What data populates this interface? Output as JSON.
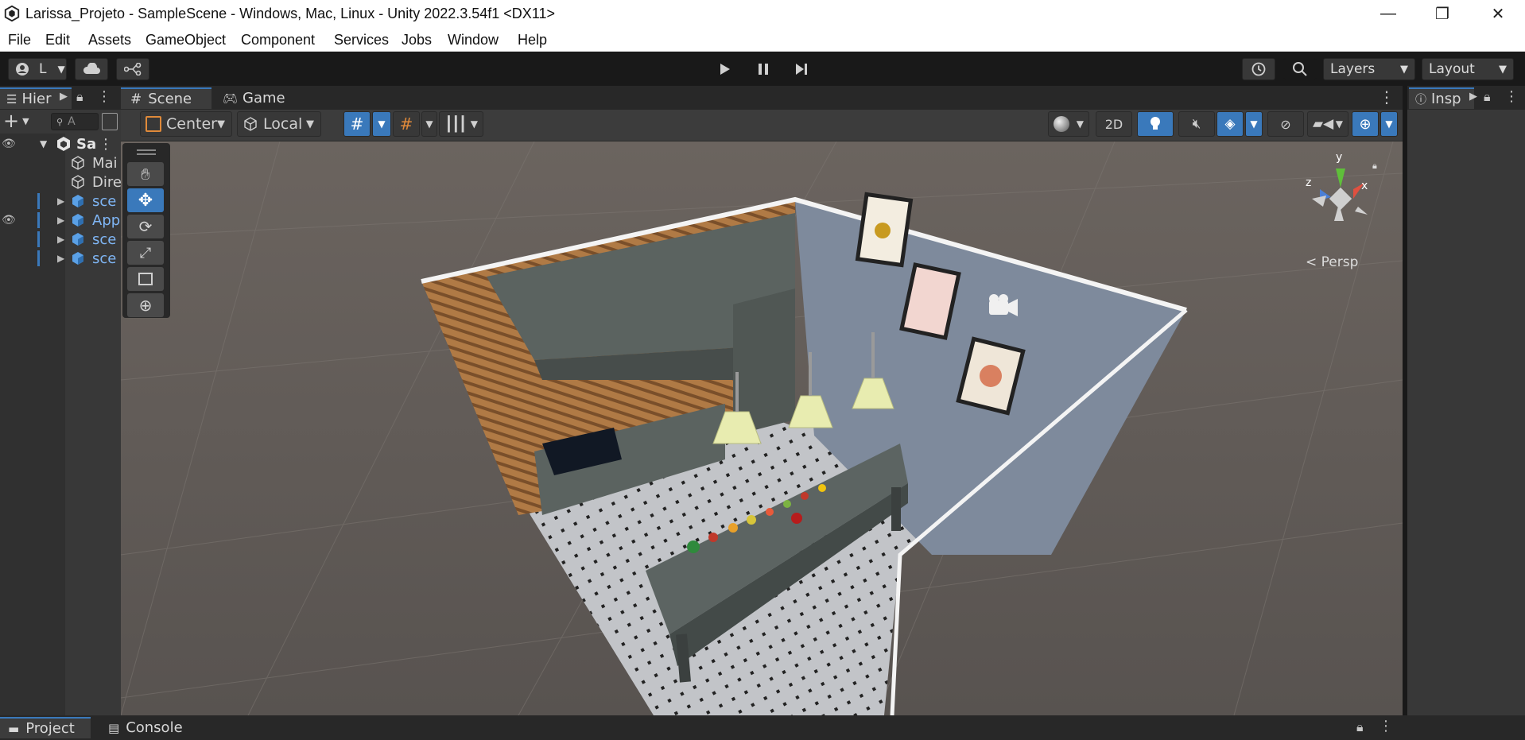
{
  "window": {
    "title": "Larissa_Projeto - SampleScene - Windows, Mac, Linux - Unity 2022.3.54f1 <DX11>",
    "minimize": "—",
    "restore": "❐",
    "close": "✕"
  },
  "menu": [
    "File",
    "Edit",
    "Assets",
    "GameObject",
    "Component",
    "Services",
    "Jobs",
    "Window",
    "Help"
  ],
  "toolbar": {
    "account_label": "L",
    "layers_label": "Layers",
    "layout_label": "Layout"
  },
  "hierarchy": {
    "tab_label": "Hier",
    "search_placeholder": "A",
    "scene_name": "Sa",
    "items": [
      {
        "label": "Mai",
        "kind": "gameobject"
      },
      {
        "label": "Dire",
        "kind": "gameobject"
      },
      {
        "label": "sce",
        "kind": "prefab"
      },
      {
        "label": "App",
        "kind": "prefab"
      },
      {
        "label": "sce",
        "kind": "prefab"
      },
      {
        "label": "sce",
        "kind": "prefab"
      }
    ]
  },
  "scene_tabs": [
    {
      "label": "Scene",
      "active": true
    },
    {
      "label": "Game",
      "active": false
    }
  ],
  "scene_toolbar": {
    "pivot_label": "Center",
    "space_label": "Local",
    "mode_2d_label": "2D"
  },
  "gizmo": {
    "y_label": "y",
    "x_label": "x",
    "z_label": "z",
    "projection_label": "Persp"
  },
  "inspector": {
    "tab_label": "Insp"
  },
  "bottom_tabs": [
    {
      "label": "Project",
      "active": true
    },
    {
      "label": "Console",
      "active": false
    }
  ],
  "colors": {
    "accent": "#3a79bb",
    "panel": "#383838",
    "background": "#191919",
    "prefab_text": "#7fb6f5"
  }
}
